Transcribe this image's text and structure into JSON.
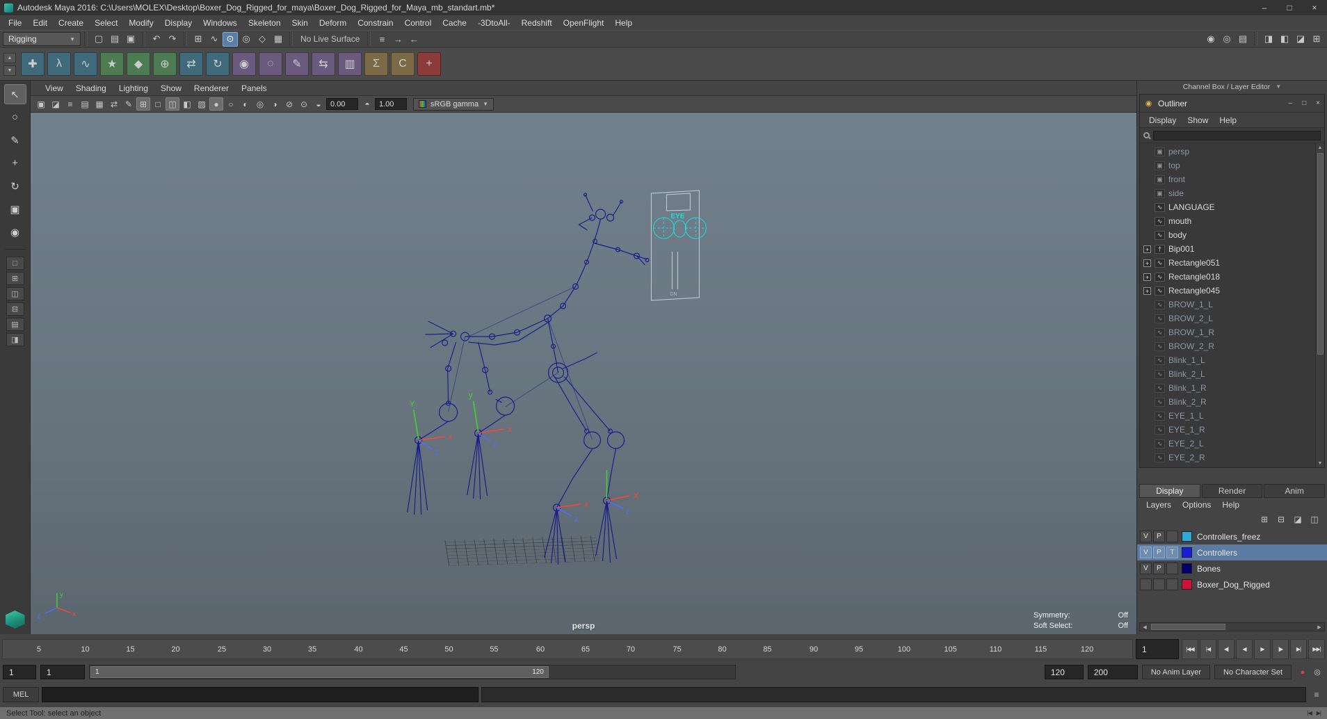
{
  "ui": {
    "dropdown_arrow": "▼",
    "up": "▲",
    "down": "▼",
    "left": "◀",
    "right": "▶",
    "minimize": "–",
    "maximize": "□",
    "close": "×"
  },
  "titlebar": {
    "title": "Autodesk Maya 2016: C:\\Users\\MOLEX\\Desktop\\Boxer_Dog_Rigged_for_maya\\Boxer_Dog_Rigged_for_Maya_mb_standart.mb*"
  },
  "menubar": {
    "items": [
      {
        "label": "File",
        "name": "menu-file"
      },
      {
        "label": "Edit",
        "name": "menu-edit"
      },
      {
        "label": "Create",
        "name": "menu-create"
      },
      {
        "label": "Select",
        "name": "menu-select"
      },
      {
        "label": "Modify",
        "name": "menu-modify"
      },
      {
        "label": "Display",
        "name": "menu-display"
      },
      {
        "label": "Windows",
        "name": "menu-windows"
      },
      {
        "label": "Skeleton",
        "name": "menu-skeleton"
      },
      {
        "label": "Skin",
        "name": "menu-skin"
      },
      {
        "label": "Deform",
        "name": "menu-deform"
      },
      {
        "label": "Constrain",
        "name": "menu-constrain"
      },
      {
        "label": "Control",
        "name": "menu-control"
      },
      {
        "label": "Cache",
        "name": "menu-cache"
      },
      {
        "label": "-3DtoAll-",
        "name": "menu-3dtoall"
      },
      {
        "label": "Redshift",
        "name": "menu-redshift"
      },
      {
        "label": "OpenFlight",
        "name": "menu-openflight"
      },
      {
        "label": "Help",
        "name": "menu-help"
      }
    ]
  },
  "status": {
    "mode": "Rigging",
    "live_surface": "No Live Surface",
    "file_icons": [
      {
        "name": "new-scene-icon",
        "glyph": "▢"
      },
      {
        "name": "open-scene-icon",
        "glyph": "▤"
      },
      {
        "name": "save-scene-icon",
        "glyph": "▣"
      }
    ],
    "undo_icons": [
      {
        "name": "undo-icon",
        "glyph": "↶"
      },
      {
        "name": "redo-icon",
        "glyph": "↷"
      }
    ],
    "snap_icons": [
      {
        "name": "snap-to-grid-icon",
        "glyph": "⊞"
      },
      {
        "name": "snap-to-curve-icon",
        "glyph": "∿"
      },
      {
        "name": "snap-to-point-icon",
        "glyph": "⊙",
        "active": true
      },
      {
        "name": "snap-to-projected-center-icon",
        "glyph": "◎"
      },
      {
        "name": "snap-to-view-plane-icon",
        "glyph": "◇"
      },
      {
        "name": "make-live-icon",
        "glyph": "▦"
      }
    ],
    "history_icons": [
      {
        "name": "construction-history-icon",
        "glyph": "≡"
      },
      {
        "name": "select-by-input-icon",
        "glyph": "→"
      },
      {
        "name": "select-by-output-icon",
        "glyph": "←"
      }
    ],
    "render_icons": [
      {
        "name": "render-current-frame-icon",
        "glyph": "◉"
      },
      {
        "name": "ipr-render-icon",
        "glyph": "◎"
      },
      {
        "name": "render-settings-icon",
        "glyph": "▤"
      }
    ],
    "sidebar_icons": [
      {
        "name": "show-attribute-editor-icon",
        "glyph": "◨"
      },
      {
        "name": "show-tool-settings-icon",
        "glyph": "◧"
      },
      {
        "name": "show-channel-box-icon",
        "glyph": "◪"
      },
      {
        "name": "show-modeling-toolkit-icon",
        "glyph": "⊞"
      }
    ]
  },
  "shelf": {
    "icons": [
      {
        "name": "shelf-joint-tool-icon",
        "glyph": "✚",
        "bg": "#40697b",
        "fg": "#d5e7f0"
      },
      {
        "name": "shelf-ik-handle-icon",
        "glyph": "λ",
        "bg": "#40697b",
        "fg": "#d5e7f0"
      },
      {
        "name": "shelf-ik-spline-icon",
        "glyph": "∿",
        "bg": "#40697b",
        "fg": "#d5e7f0"
      },
      {
        "name": "shelf-quick-rig-icon",
        "glyph": "★",
        "bg": "#4d7c52",
        "fg": "#dff0da"
      },
      {
        "name": "shelf-humanik-icon",
        "glyph": "◆",
        "bg": "#4d7c52",
        "fg": "#dff0da"
      },
      {
        "name": "shelf-create-character-icon",
        "glyph": "⊕",
        "bg": "#4d7c52",
        "fg": "#dff0da"
      },
      {
        "name": "shelf-mirror-joint-icon",
        "glyph": "⇄",
        "bg": "#40697b",
        "fg": "#d5e7f0"
      },
      {
        "name": "shelf-orient-joint-icon",
        "glyph": "↻",
        "bg": "#40697b",
        "fg": "#d5e7f0"
      },
      {
        "name": "shelf-bind-skin-icon",
        "glyph": "◉",
        "bg": "#6a5a7d",
        "fg": "#e9e0f2"
      },
      {
        "name": "shelf-unbind-skin-icon",
        "glyph": "◌",
        "bg": "#6a5a7d",
        "fg": "#e9e0f2"
      },
      {
        "name": "shelf-paint-skin-weights-icon",
        "glyph": "✎",
        "bg": "#6a5a7d",
        "fg": "#e9e0f2"
      },
      {
        "name": "shelf-mirror-skin-weights-icon",
        "glyph": "⇆",
        "bg": "#6a5a7d",
        "fg": "#e9e0f2"
      },
      {
        "name": "shelf-copy-skin-weights-icon",
        "glyph": "▥",
        "bg": "#6a5a7d",
        "fg": "#e9e0f2"
      },
      {
        "name": "shelf-blend-shape-icon",
        "glyph": "Σ",
        "bg": "#7c6a46",
        "fg": "#f2e8cf"
      },
      {
        "name": "shelf-cluster-icon",
        "glyph": "C",
        "bg": "#7c6a46",
        "fg": "#f2e8cf"
      },
      {
        "name": "shelf-add-attribute-icon",
        "glyph": "+",
        "bg": "#8d3a3a",
        "fg": "#ffdada"
      }
    ]
  },
  "toolbox": {
    "tools": [
      {
        "name": "select-tool-button",
        "glyph": "↖",
        "active": true
      },
      {
        "name": "lasso-tool-button",
        "glyph": "○"
      },
      {
        "name": "paint-select-tool-button",
        "glyph": "✎"
      },
      {
        "name": "move-tool-button",
        "glyph": "+"
      },
      {
        "name": "rotate-tool-button",
        "glyph": "↻"
      },
      {
        "name": "scale-tool-button",
        "glyph": "▣"
      },
      {
        "name": "soft-mod-tool-button",
        "glyph": "◉"
      }
    ],
    "layouts": [
      {
        "name": "single-pane-layout-button",
        "glyph": "□"
      },
      {
        "name": "four-pane-layout-button",
        "glyph": "⊞"
      },
      {
        "name": "persp-outliner-layout-button",
        "glyph": "◫"
      },
      {
        "name": "persp-graph-layout-button",
        "glyph": "⊟"
      },
      {
        "name": "hypershade-persp-layout-button",
        "glyph": "▤"
      },
      {
        "name": "persp-uv-editor-layout-button",
        "glyph": "◨"
      }
    ]
  },
  "panelmenu": {
    "items": [
      {
        "label": "View",
        "name": "panel-menu-view"
      },
      {
        "label": "Shading",
        "name": "panel-menu-shading"
      },
      {
        "label": "Lighting",
        "name": "panel-menu-lighting"
      },
      {
        "label": "Show",
        "name": "panel-menu-show"
      },
      {
        "label": "Renderer",
        "name": "panel-menu-renderer"
      },
      {
        "label": "Panels",
        "name": "panel-menu-panels"
      }
    ]
  },
  "viewbar": {
    "icons": [
      {
        "name": "select-camera-icon",
        "glyph": "▣"
      },
      {
        "name": "lock-camera-icon",
        "glyph": "◪"
      },
      {
        "name": "camera-attributes-icon",
        "glyph": "≡"
      },
      {
        "name": "bookmarks-icon",
        "glyph": "▤"
      },
      {
        "name": "image-plane-icon",
        "glyph": "▦"
      },
      {
        "name": "2d-pan-zoom-icon",
        "glyph": "⇄"
      },
      {
        "name": "grease-pencil-icon",
        "glyph": "✎"
      },
      {
        "name": "grid-toggle-icon",
        "glyph": "⊞",
        "active": true
      },
      {
        "name": "film-gate-icon",
        "glyph": "□"
      },
      {
        "name": "resolution-gate-icon",
        "glyph": "◫",
        "active": true
      },
      {
        "name": "gate-mask-icon",
        "glyph": "◧"
      },
      {
        "name": "field-chart-icon",
        "glyph": "▨"
      },
      {
        "name": "shaded-mode-icon",
        "glyph": "●",
        "active": true
      },
      {
        "name": "wireframe-mode-icon",
        "glyph": "○"
      },
      {
        "name": "textured-mode-icon",
        "glyph": "◐"
      },
      {
        "name": "lights-toggle-icon",
        "glyph": "◎"
      },
      {
        "name": "shadows-toggle-icon",
        "glyph": "◑"
      },
      {
        "name": "xray-mode-icon",
        "glyph": "⊘"
      },
      {
        "name": "isolate-select-icon",
        "glyph": "⊙"
      }
    ],
    "exposure_icon": {
      "glyph": "◒"
    },
    "gamma_icon": {
      "glyph": "◓"
    },
    "exposure": "0.00",
    "gamma": "1.00",
    "colorspace": "sRGB gamma"
  },
  "viewport": {
    "camera": "persp",
    "hud": [
      {
        "label": "Symmetry:",
        "value": "Off"
      },
      {
        "label": "Soft Select:",
        "value": "Off"
      }
    ],
    "axis": {
      "x": "x",
      "y": "y",
      "z": "z",
      "x_cap": "X",
      "y_cap": "Y"
    },
    "eye": {
      "title": "EYE",
      "sub": "DN"
    }
  },
  "panel_header": {
    "title": "Channel Box / Layer Editor"
  },
  "outliner": {
    "title": "Outliner",
    "icon_glyph": "◉",
    "menus": [
      {
        "label": "Display",
        "name": "outliner-menu-display"
      },
      {
        "label": "Show",
        "name": "outliner-menu-show"
      },
      {
        "label": "Help",
        "name": "outliner-menu-help"
      }
    ],
    "items": [
      {
        "label": "persp",
        "icon": "camera-icon",
        "glyph": "▣",
        "dim": true
      },
      {
        "label": "top",
        "icon": "camera-icon",
        "glyph": "▣",
        "dim": true
      },
      {
        "label": "front",
        "icon": "camera-icon",
        "glyph": "▣",
        "dim": true
      },
      {
        "label": "side",
        "icon": "camera-icon",
        "glyph": "▣",
        "dim": true
      },
      {
        "label": "LANGUAGE",
        "icon": "nurbs-curve-icon",
        "glyph": "∿"
      },
      {
        "label": "mouth",
        "icon": "nurbs-curve-icon",
        "glyph": "∿"
      },
      {
        "label": "body",
        "icon": "nurbs-curve-icon",
        "glyph": "∿"
      },
      {
        "label": "Bip001",
        "icon": "joint-icon",
        "glyph": "†",
        "expand": true,
        "exp": "+"
      },
      {
        "label": "Rectangle051",
        "icon": "nurbs-curve-icon",
        "glyph": "∿",
        "expand": true,
        "exp": "+"
      },
      {
        "label": "Rectangle018",
        "icon": "nurbs-curve-icon",
        "glyph": "∿",
        "expand": true,
        "exp": "+"
      },
      {
        "label": "Rectangle045",
        "icon": "nurbs-curve-icon",
        "glyph": "∿",
        "expand": true,
        "exp": "+"
      },
      {
        "label": "BROW_1_L",
        "icon": "nurbs-curve-icon",
        "glyph": "∿",
        "dim": true
      },
      {
        "label": "BROW_2_L",
        "icon": "nurbs-curve-icon",
        "glyph": "∿",
        "dim": true
      },
      {
        "label": "BROW_1_R",
        "icon": "nurbs-curve-icon",
        "glyph": "∿",
        "dim": true
      },
      {
        "label": "BROW_2_R",
        "icon": "nurbs-curve-icon",
        "glyph": "∿",
        "dim": true
      },
      {
        "label": "Blink_1_L",
        "icon": "nurbs-curve-icon",
        "glyph": "∿",
        "dim": true
      },
      {
        "label": "Blink_2_L",
        "icon": "nurbs-curve-icon",
        "glyph": "∿",
        "dim": true
      },
      {
        "label": "Blink_1_R",
        "icon": "nurbs-curve-icon",
        "glyph": "∿",
        "dim": true
      },
      {
        "label": "Blink_2_R",
        "icon": "nurbs-curve-icon",
        "glyph": "∿",
        "dim": true
      },
      {
        "label": "EYE_1_L",
        "icon": "nurbs-curve-icon",
        "glyph": "∿",
        "dim": true
      },
      {
        "label": "EYE_1_R",
        "icon": "nurbs-curve-icon",
        "glyph": "∿",
        "dim": true
      },
      {
        "label": "EYE_2_L",
        "icon": "nurbs-curve-icon",
        "glyph": "∿",
        "dim": true
      },
      {
        "label": "EYE_2_R",
        "icon": "nurbs-curve-icon",
        "glyph": "∿",
        "dim": true
      }
    ]
  },
  "layer_editor": {
    "tabs": [
      {
        "label": "Display",
        "name": "tab-display",
        "active": true
      },
      {
        "label": "Render",
        "name": "tab-render"
      },
      {
        "label": "Anim",
        "name": "tab-anim"
      }
    ],
    "menus": [
      {
        "label": "Layers",
        "name": "layer-menu-layers"
      },
      {
        "label": "Options",
        "name": "layer-menu-options"
      },
      {
        "label": "Help",
        "name": "layer-menu-help"
      }
    ],
    "tool_icons": [
      {
        "name": "add-empty-layer-button",
        "glyph": "⊞"
      },
      {
        "name": "add-selected-layer-button",
        "glyph": "⊟"
      },
      {
        "name": "layer-options-icon",
        "glyph": "◪"
      },
      {
        "name": "layer-sort-icon",
        "glyph": "◫"
      }
    ],
    "layers": [
      {
        "c1": "V",
        "c2": "P",
        "c3": "",
        "color": "#2fa8d8",
        "name": "Controllers_freez"
      },
      {
        "c1": "V",
        "c2": "P",
        "c3": "T",
        "color": "#1b1bd8",
        "name": "Controllers",
        "selected": true
      },
      {
        "c1": "V",
        "c2": "P",
        "c3": "",
        "color": "#00006b",
        "name": "Bones"
      },
      {
        "c1": "",
        "c2": "",
        "c3": "",
        "color": "#cf1238",
        "name": "Boxer_Dog_Rigged"
      }
    ]
  },
  "timeline": {
    "marker": "1",
    "frame_field": "1",
    "ticks": [
      {
        "t": "5",
        "pos": 3.2
      },
      {
        "t": "10",
        "pos": 7.3
      },
      {
        "t": "15",
        "pos": 11.3
      },
      {
        "t": "20",
        "pos": 15.3
      },
      {
        "t": "25",
        "pos": 19.4
      },
      {
        "t": "30",
        "pos": 23.4
      },
      {
        "t": "35",
        "pos": 27.4
      },
      {
        "t": "40",
        "pos": 31.5
      },
      {
        "t": "45",
        "pos": 35.5
      },
      {
        "t": "50",
        "pos": 39.5
      },
      {
        "t": "55",
        "pos": 43.5
      },
      {
        "t": "60",
        "pos": 47.6
      },
      {
        "t": "65",
        "pos": 51.6
      },
      {
        "t": "70",
        "pos": 55.6
      },
      {
        "t": "75",
        "pos": 59.7
      },
      {
        "t": "80",
        "pos": 63.7
      },
      {
        "t": "85",
        "pos": 67.7
      },
      {
        "t": "90",
        "pos": 71.8
      },
      {
        "t": "95",
        "pos": 75.8
      },
      {
        "t": "100",
        "pos": 79.8
      },
      {
        "t": "105",
        "pos": 83.9
      },
      {
        "t": "110",
        "pos": 87.9
      },
      {
        "t": "115",
        "pos": 91.9
      },
      {
        "t": "120",
        "pos": 96.0
      }
    ],
    "playback": [
      {
        "name": "go-to-start-button",
        "glyph": "|◀◀"
      },
      {
        "name": "step-back-key-button",
        "glyph": "|◀"
      },
      {
        "name": "step-back-frame-button",
        "glyph": "◀|"
      },
      {
        "name": "play-backwards-button",
        "glyph": "◀"
      },
      {
        "name": "play-forwards-button",
        "glyph": "▶"
      },
      {
        "name": "step-forward-frame-button",
        "glyph": "|▶"
      },
      {
        "name": "step-forward-key-button",
        "glyph": "▶|"
      },
      {
        "name": "go-to-end-button",
        "glyph": "▶▶|"
      }
    ]
  },
  "range": {
    "range_start": "1",
    "play_start": "1",
    "bar_left": "1",
    "bar_right": "120",
    "play_end": "120",
    "range_end": "200",
    "anim_layer": "No Anim Layer",
    "char_set": "No Character Set",
    "icons": [
      {
        "name": "auto-keyframe-toggle-icon",
        "glyph": "●",
        "color": "#d04545"
      },
      {
        "name": "animation-preferences-icon",
        "glyph": "◎",
        "color": "#cfcfcf"
      }
    ]
  },
  "mel": {
    "label": "MEL",
    "script_icon": "≡"
  },
  "help": {
    "text": "Select Tool: select an object",
    "icons": [
      {
        "name": "prev-key-mini-icon",
        "glyph": "|◀"
      },
      {
        "name": "next-key-mini-icon",
        "glyph": "▶|"
      }
    ]
  }
}
